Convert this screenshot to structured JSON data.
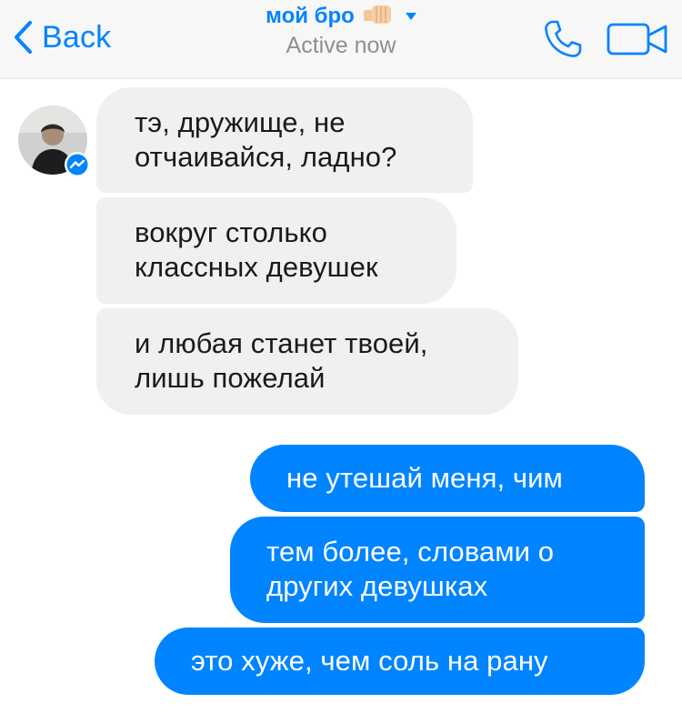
{
  "header": {
    "back_label": "Back",
    "title": "мой бро",
    "title_emoji": "fist-bump-emoji",
    "status": "Active now",
    "icons": [
      "chevron-left-icon",
      "caret-down-icon",
      "phone-icon",
      "video-camera-icon",
      "messenger-badge-icon"
    ],
    "accent_color": "#0084ff"
  },
  "messages": [
    {
      "direction": "incoming",
      "text": "тэ, дружище, не отчаивайся, ладно?",
      "lines": [
        "тэ, дружище, не",
        "отчаивайся, ладно?"
      ]
    },
    {
      "direction": "incoming",
      "text": "вокруг столько классных девушек",
      "lines": [
        "вокруг столько",
        "классных девушек"
      ]
    },
    {
      "direction": "incoming",
      "text": "и любая станет твоей, лишь пожелай",
      "lines": [
        "и любая станет твоей,",
        "лишь пожелай"
      ]
    },
    {
      "direction": "outgoing",
      "text": "не утешай меня, чим",
      "lines": [
        "не утешай меня, чим"
      ]
    },
    {
      "direction": "outgoing",
      "text": "тем более, словами о других девушках",
      "lines": [
        "тем более, словами о",
        "других девушках"
      ]
    },
    {
      "direction": "outgoing",
      "text": "это хуже, чем соль на рану",
      "lines": [
        "это хуже, чем соль на рану"
      ]
    }
  ],
  "colors": {
    "incoming_bubble": "#f1f0f0",
    "outgoing_bubble": "#0084ff",
    "header_bg": "#f7f7f7",
    "status_text": "#8e8e93"
  }
}
